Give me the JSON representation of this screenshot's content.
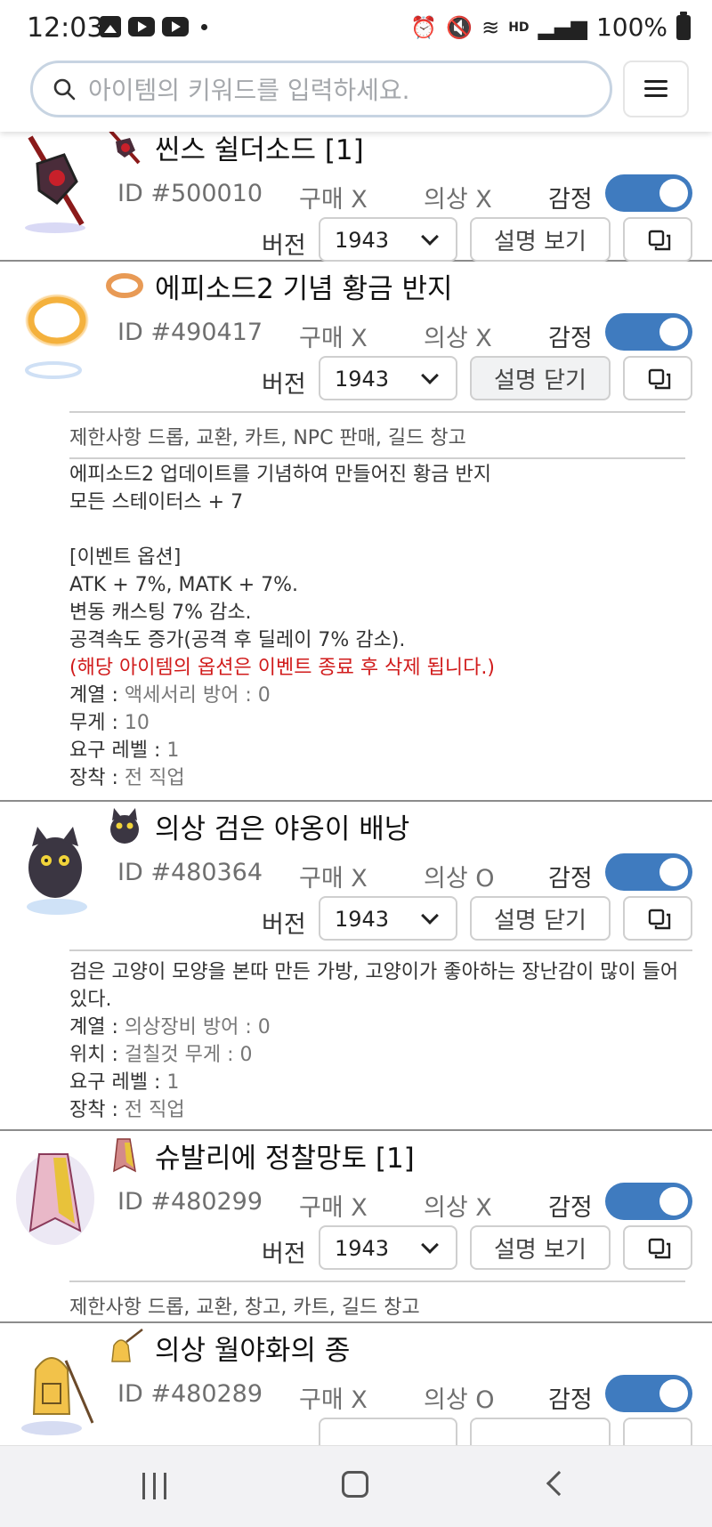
{
  "status_bar": {
    "time": "12:03",
    "battery": "100%",
    "hd_label": "HD"
  },
  "search": {
    "placeholder": "아이템의 키워드를 입력하세요."
  },
  "items": [
    {
      "name": "씬스 쉴더소드 [1]",
      "id": "ID #500010",
      "buy": "구매 X",
      "costume": "의상 X",
      "appraise": "감정",
      "appraise_on": true,
      "version_label": "버전",
      "version": "1943",
      "desc_button": "설명 보기",
      "icon": "shield-sword-icon"
    },
    {
      "name": "에피소드2 기념 황금 반지",
      "id": "ID #490417",
      "buy": "구매 X",
      "costume": "의상 X",
      "appraise": "감정",
      "appraise_on": true,
      "version_label": "버전",
      "version": "1943",
      "desc_button": "설명 닫기",
      "icon": "golden-ring-icon",
      "restriction": "제한사항 드롭, 교환, 카트, NPC 판매, 길드 창고",
      "details": {
        "line1": "에피소드2 업데이트를 기념하여 만들어진 황금 반지",
        "line2": "모든 스테이터스 + 7",
        "line3": "[이벤트 옵션]",
        "line4": "ATK + 7%, MATK + 7%.",
        "line5": "변동 캐스팅 7% 감소.",
        "line6": "공격속도 증가(공격 후 딜레이 7% 감소).",
        "warning": "(해당 아이템의 옵션은 이벤트 종료 후 삭제 됩니다.)",
        "type_key": "계열 : ",
        "type_val": "액세서리 방어 : 0",
        "weight_key": "무게 : ",
        "weight_val": "10",
        "level_key": "요구 레벨 : ",
        "level_val": "1",
        "equip_key": "장착 : ",
        "equip_val": "전 직업"
      }
    },
    {
      "name": "의상 검은 야옹이 배낭",
      "id": "ID #480364",
      "buy": "구매 X",
      "costume": "의상 O",
      "appraise": "감정",
      "appraise_on": true,
      "version_label": "버전",
      "version": "1943",
      "desc_button": "설명 닫기",
      "icon": "black-cat-backpack-icon",
      "details": {
        "line1": "검은 고양이 모양을 본따 만든 가방, 고양이가 좋아하는 장난감이 많이 들어 있다.",
        "type_key": "계열 : ",
        "type_val": "의상장비 방어 : 0",
        "pos_key": "위치 : ",
        "pos_val": "걸칠것 무게 : 0",
        "level_key": "요구 레벨 : ",
        "level_val": "1",
        "equip_key": "장착 : ",
        "equip_val": "전 직업"
      }
    },
    {
      "name": "슈발리에 정찰망토 [1]",
      "id": "ID #480299",
      "buy": "구매 X",
      "costume": "의상 X",
      "appraise": "감정",
      "appraise_on": true,
      "version_label": "버전",
      "version": "1943",
      "desc_button": "설명 보기",
      "icon": "scout-cloak-icon",
      "restriction": "제한사항 드롭, 교환, 창고, 카트, 길드 창고"
    },
    {
      "name": "의상 월야화의 종",
      "id": "ID #480289",
      "buy": "구매 X",
      "costume": "의상 O",
      "appraise": "감정",
      "appraise_on": true,
      "icon": "moon-bell-icon"
    }
  ]
}
